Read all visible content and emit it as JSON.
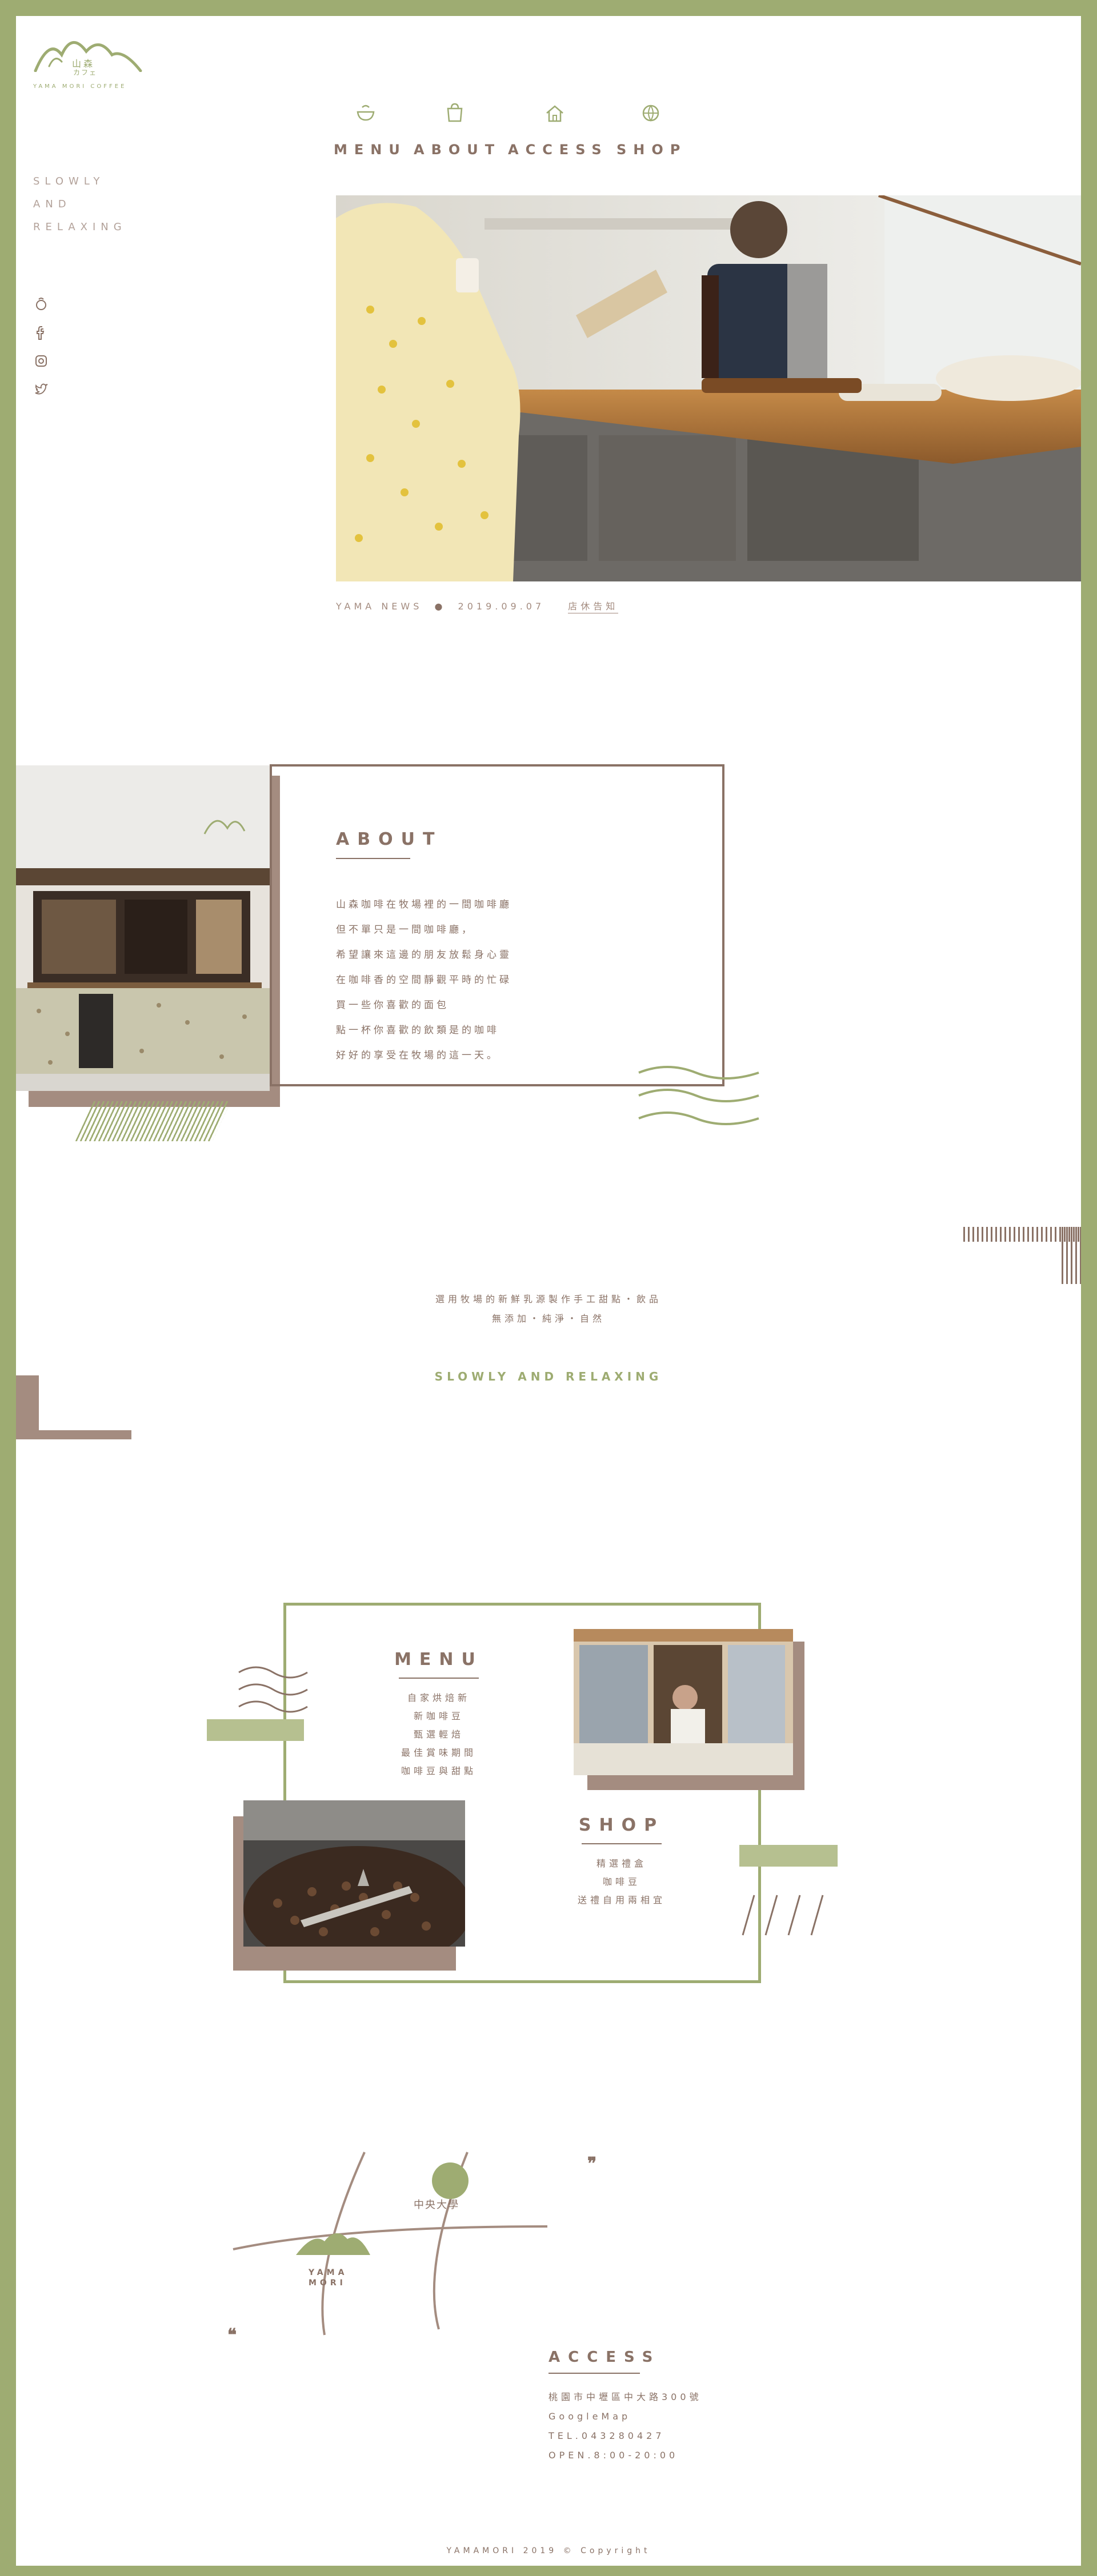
{
  "header": {
    "logo_title": "山森",
    "logo_katakana": "カフェ",
    "logo_sub": "YAMA MORI COFFEE",
    "slogan": [
      "SLOWLY",
      "AND",
      "RELAXING"
    ]
  },
  "social": [
    {
      "name": "coffee-icon"
    },
    {
      "name": "facebook-icon"
    },
    {
      "name": "instagram-icon"
    },
    {
      "name": "twitter-icon"
    }
  ],
  "nav": [
    {
      "label": "MENU",
      "icon": "bowl-icon"
    },
    {
      "label": "ABOUT",
      "icon": "bag-icon"
    },
    {
      "label": "ACCESS",
      "icon": "home-icon"
    },
    {
      "label": "SHOP",
      "icon": "globe-icon"
    }
  ],
  "news": {
    "label": "YAMA NEWS",
    "bullet": "●",
    "date": "2019.09.07",
    "title": "店休告知"
  },
  "about": {
    "title": "ABOUT",
    "lines": [
      "山森咖啡在牧場裡的一間咖啡廳",
      "但不單只是一間咖啡廳，",
      "希望讓來這邊的朋友放鬆身心靈",
      "在咖啡香的空間靜觀平時的忙碌",
      "買一些你喜歡的面包",
      "點一杯你喜歡的飲類是的咖啡",
      "好好的享受在牧場的這一天。"
    ]
  },
  "mid": {
    "line1": "選用牧場的新鮮乳源製作手工甜點・飲品",
    "line2": "無添加・純淨・自然",
    "tagline": "SLOWLY AND RELAXING"
  },
  "menu": {
    "title": "MENU",
    "items": [
      "自家烘焙新",
      "新咖啡豆",
      "甄選輕焙",
      "最佳賞味期間",
      "咖啡豆與甜點"
    ]
  },
  "shop": {
    "title": "SHOP",
    "items": [
      "精選禮盒",
      "咖啡豆",
      "送禮自用兩相宜"
    ]
  },
  "map": {
    "university": "中央大學",
    "place": "YAMA MORI"
  },
  "access": {
    "title": "ACCESS",
    "address": "桃園市中壢區中大路300號",
    "map_link": "GoogleMap",
    "tel": "TEL.043280427",
    "hours": "OPEN.8:00-20:00"
  },
  "footer": {
    "copyright": "YAMAMORI 2019 © Copyright"
  },
  "colors": {
    "green": "#9eac72",
    "brown": "#8a7266",
    "light_brown": "#a48c80",
    "white": "#ffffff"
  }
}
